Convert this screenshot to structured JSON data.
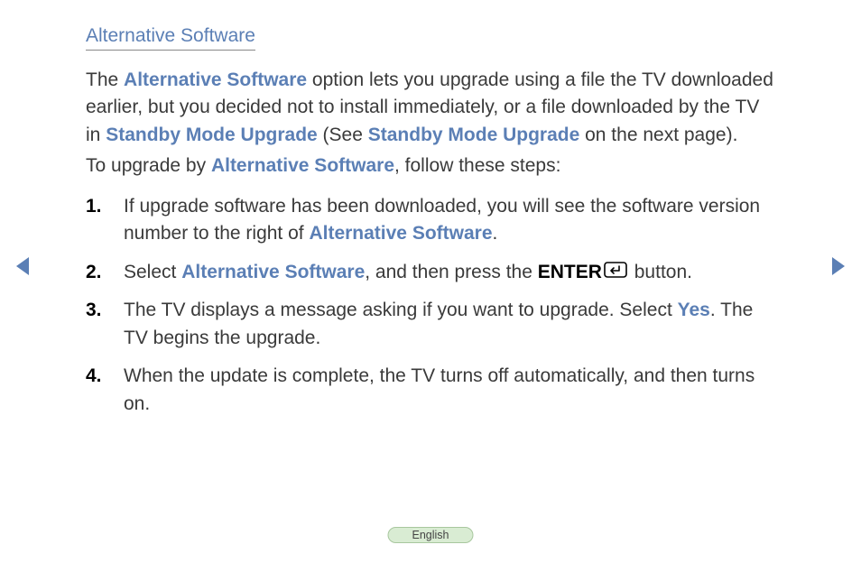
{
  "heading": "Alternative Software",
  "para1": {
    "t1": "The ",
    "term1": "Alternative Software",
    "t2": " option lets you upgrade using a file the TV downloaded earlier, but you decided not to install immediately, or a file downloaded by the TV in ",
    "term2": "Standby Mode Upgrade",
    "t3": " (See ",
    "term3": "Standby Mode Upgrade",
    "t4": " on the next page)."
  },
  "para2": {
    "t1": "To upgrade by ",
    "term1": "Alternative Software",
    "t2": ", follow these steps:"
  },
  "steps": [
    {
      "num": "1.",
      "t1": "If upgrade software has been downloaded, you will see the software version number to the right of ",
      "term1": "Alternative Software",
      "t2": "."
    },
    {
      "num": "2.",
      "t1": "Select ",
      "term1": "Alternative Software",
      "t2": ", and then press the ",
      "bold1": "ENTER",
      "t3": " button."
    },
    {
      "num": "3.",
      "t1": "The TV displays a message asking if you want to upgrade. Select ",
      "term1": "Yes",
      "t2": ". The TV begins the upgrade."
    },
    {
      "num": "4.",
      "t1": "When the update is complete, the TV turns off automatically, and then turns on."
    }
  ],
  "language": "English"
}
